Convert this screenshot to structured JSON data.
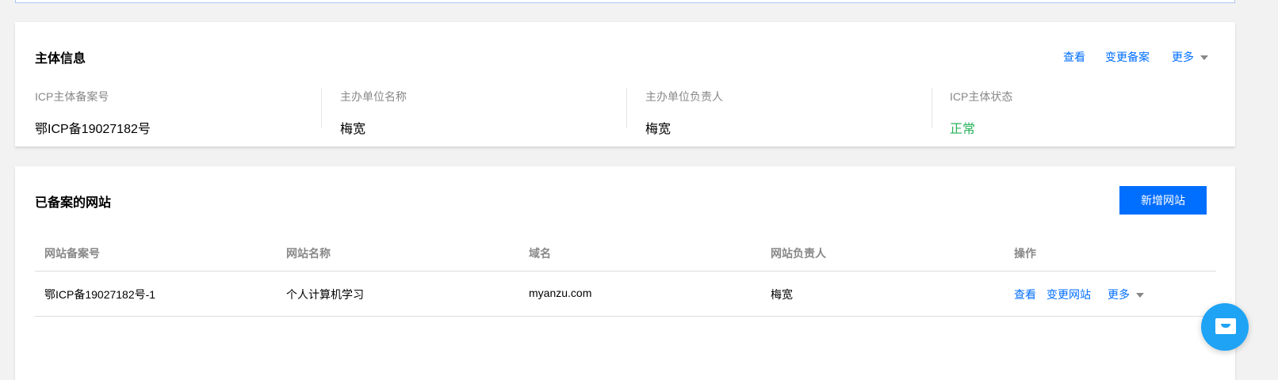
{
  "subject": {
    "title": "主体信息",
    "actions": {
      "view": "查看",
      "change": "变更备案",
      "more": "更多"
    },
    "fields": [
      {
        "label": "ICP主体备案号",
        "value": "鄂ICP备19027182号"
      },
      {
        "label": "主办单位名称",
        "value": "梅宽"
      },
      {
        "label": "主办单位负责人",
        "value": "梅宽"
      },
      {
        "label": "ICP主体状态",
        "value": "正常"
      }
    ],
    "status_color": "#29b35c"
  },
  "sites": {
    "title": "已备案的网站",
    "add_button": "新增网站",
    "columns": [
      "网站备案号",
      "网站名称",
      "域名",
      "网站负责人",
      "操作"
    ],
    "rows": [
      {
        "record": "鄂ICP备19027182号-1",
        "name": "个人计算机学习",
        "domain": "myanzu.com",
        "owner": "梅宽",
        "actions": {
          "view": "查看",
          "change": "变更网站",
          "more": "更多"
        }
      }
    ]
  },
  "chat": {
    "icon": "chat-bubble-icon"
  }
}
